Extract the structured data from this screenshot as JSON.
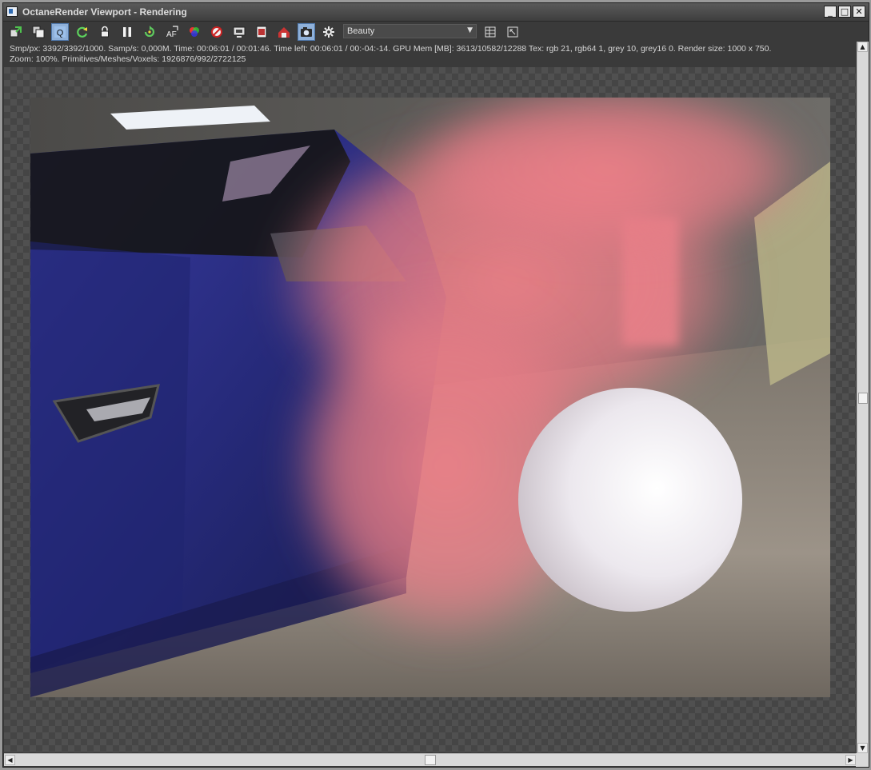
{
  "window": {
    "title": "OctaneRender Viewport - Rendering",
    "controls": {
      "minimize": "_",
      "maximize": "□",
      "close": "✕"
    }
  },
  "toolbar": {
    "buttons": [
      {
        "name": "send-to-picture-viewer-icon",
        "active": false
      },
      {
        "name": "clone-viewport-icon",
        "active": false
      },
      {
        "name": "quick-render-q-icon",
        "label": "Q",
        "active": true
      },
      {
        "name": "restart-render-icon",
        "active": false
      },
      {
        "name": "lock-resolution-icon",
        "active": false
      },
      {
        "name": "pause-icon",
        "active": false
      },
      {
        "name": "refresh-icon",
        "active": false
      },
      {
        "name": "autofocus-af-icon",
        "label": "AF",
        "active": false
      },
      {
        "name": "color-picker-icon",
        "active": false
      },
      {
        "name": "material-pick-icon",
        "active": false
      },
      {
        "name": "region-render-icon",
        "active": false
      },
      {
        "name": "film-region-icon",
        "active": false
      },
      {
        "name": "lock-camera-icon",
        "active": false
      },
      {
        "name": "camera-snapshot-icon",
        "active": true
      },
      {
        "name": "settings-gear-icon",
        "active": false
      }
    ],
    "render_pass": {
      "selected": "Beauty"
    },
    "extra_buttons": [
      "layout-grid-icon",
      "fit-to-window-icon"
    ]
  },
  "info": {
    "line1": "Smp/px: 3392/3392/1000.   Samp/s: 0,000M.   Time: 00:06:01 / 00:01:46.   Time left: 00:06:01 / 00:-04:-14.   GPU Mem [MB]: 3613/10582/12288   Tex: rgb 21, rgb64 1, grey 10, grey16 0.   Render size: 1000 x 750.",
    "line2": "Zoom: 100%.   Primitives/Meshes/Voxels: 1926876/992/2722125"
  },
  "colors": {
    "accent_active": "#8fb0d8",
    "smoke": "#e87d86",
    "car_paint": "#2d2f86",
    "sphere": "#ffffff"
  }
}
